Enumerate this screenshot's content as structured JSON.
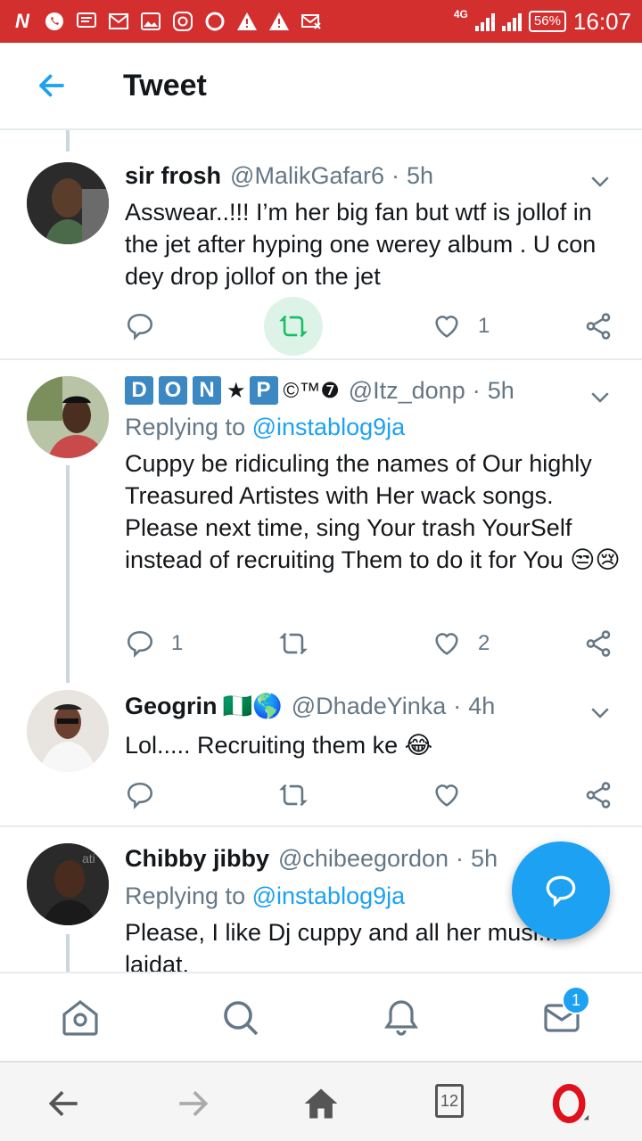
{
  "status_bar": {
    "network": "4G",
    "battery": "56%",
    "time": "16:07"
  },
  "header": {
    "title": "Tweet"
  },
  "tweets": [
    {
      "name": "sir frosh",
      "handle": "@MalikGafar6",
      "time": "5h",
      "body": "Asswear..!!! I’m her big fan but wtf is jollof in the jet after hyping one werey album . U con dey drop jollof on the jet",
      "likes": "1"
    },
    {
      "name_letters": [
        "D",
        "O",
        "N"
      ],
      "name_star": "★",
      "name_p": "P",
      "name_symbols": "©™❼",
      "handle": "@Itz_donp",
      "time": "5h",
      "replying_prefix": "Replying to",
      "replying_to": "@instablog9ja",
      "body": "Cuppy be ridiculing  the names of Our highly Treasured Artistes with Her wack songs. Please next time, sing Your trash YourSelf instead of recruiting Them to do it for You 😒😢",
      "replies": "1",
      "likes": "2"
    },
    {
      "name": "Geogrin",
      "name_emoji": "🇳🇬🌎",
      "handle": "@DhadeYinka",
      "time": "4h",
      "body": "Lol..... Recruiting them ke 😂"
    },
    {
      "name": "Chibby jibby",
      "handle": "@chibeegordon",
      "time": "5h",
      "replying_prefix": "Replying to",
      "replying_to": "@instablog9ja",
      "body": "Please, I like Dj cuppy and all her musi... laidat."
    }
  ],
  "tab_bar": {
    "notifications_badge": "1"
  },
  "browser_bar": {
    "tabs_count": "12"
  },
  "colors": {
    "status_bar": "#d32f2f",
    "accent": "#1da1f2",
    "retweet_highlight": "#ddf3e8"
  }
}
